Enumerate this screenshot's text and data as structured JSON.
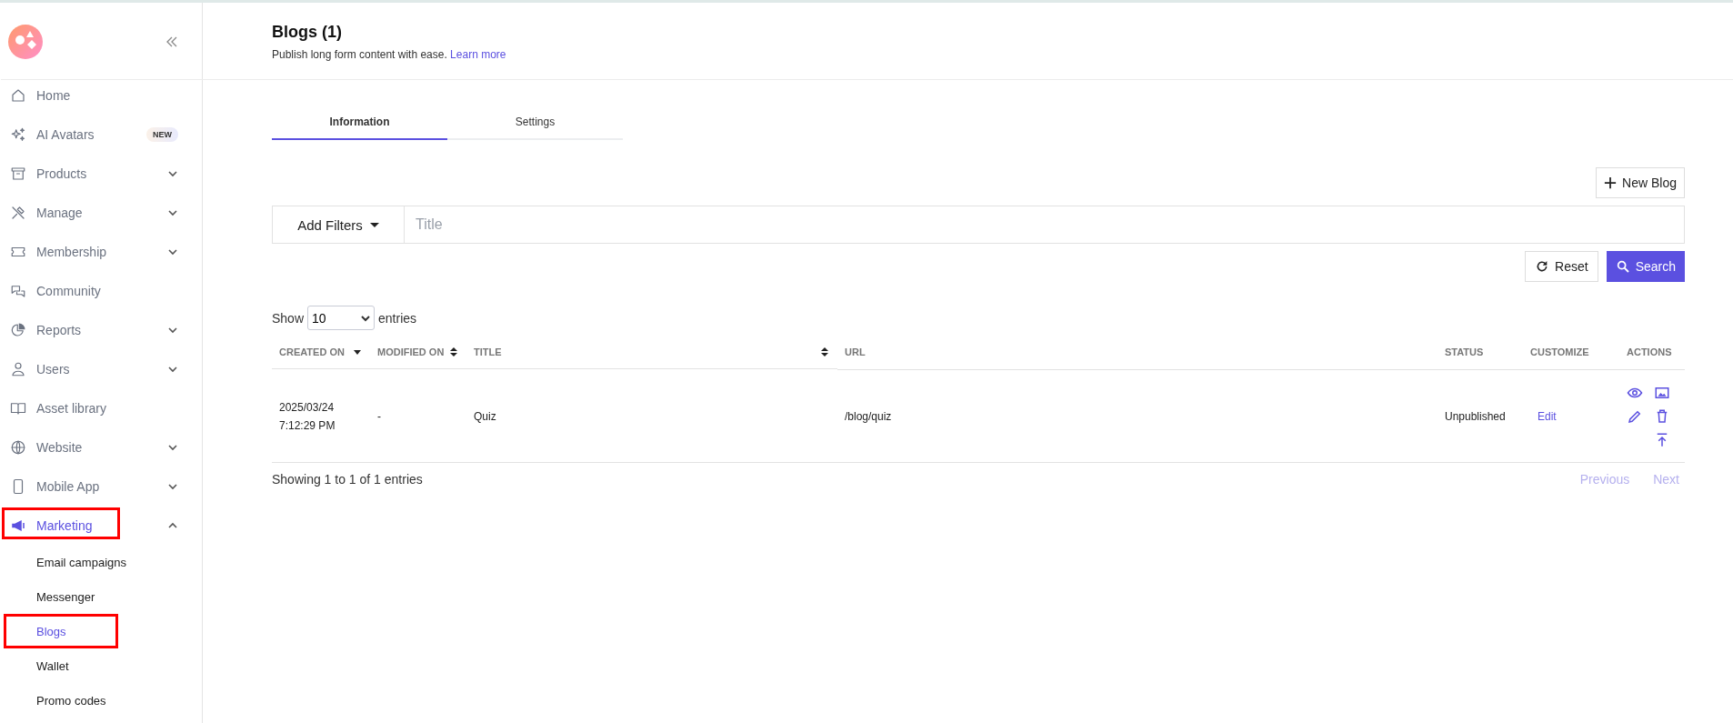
{
  "sidebar": {
    "items": [
      {
        "label": "Home",
        "has_chevron": false,
        "selected": false,
        "highlighted": false
      },
      {
        "label": "AI Avatars",
        "badge": "NEW",
        "has_chevron": false,
        "selected": false,
        "highlighted": false
      },
      {
        "label": "Products",
        "has_chevron": true,
        "expanded": false,
        "selected": false,
        "highlighted": false
      },
      {
        "label": "Manage",
        "has_chevron": true,
        "expanded": false,
        "selected": false,
        "highlighted": false
      },
      {
        "label": "Membership",
        "has_chevron": true,
        "expanded": false,
        "selected": false,
        "highlighted": false
      },
      {
        "label": "Community",
        "has_chevron": false,
        "selected": false,
        "highlighted": false
      },
      {
        "label": "Reports",
        "has_chevron": true,
        "expanded": false,
        "selected": false,
        "highlighted": false
      },
      {
        "label": "Users",
        "has_chevron": true,
        "expanded": false,
        "selected": false,
        "highlighted": false
      },
      {
        "label": "Asset library",
        "has_chevron": false,
        "selected": false,
        "highlighted": false
      },
      {
        "label": "Website",
        "has_chevron": true,
        "expanded": false,
        "selected": false,
        "highlighted": false
      },
      {
        "label": "Mobile App",
        "has_chevron": true,
        "expanded": false,
        "selected": false,
        "highlighted": false
      },
      {
        "label": "Marketing",
        "has_chevron": true,
        "expanded": true,
        "selected": true,
        "highlighted": true,
        "children": [
          {
            "label": "Email campaigns",
            "selected": false,
            "highlighted": false
          },
          {
            "label": "Messenger",
            "selected": false,
            "highlighted": false
          },
          {
            "label": "Blogs",
            "selected": true,
            "highlighted": true
          },
          {
            "label": "Wallet",
            "selected": false,
            "highlighted": false
          },
          {
            "label": "Promo codes",
            "selected": false,
            "highlighted": false
          }
        ]
      }
    ]
  },
  "header": {
    "title": "Blogs (1)",
    "subtitle": "Publish long form content with ease.",
    "link": "Learn more"
  },
  "tabs": [
    {
      "label": "Information",
      "selected": true
    },
    {
      "label": "Settings",
      "selected": false
    }
  ],
  "new_button": "New Blog",
  "filters": {
    "button": "Add Filters",
    "placeholder": "Title"
  },
  "reset_button": "Reset",
  "search_button": "Search",
  "page_size": {
    "before": "Show",
    "value": "10",
    "after": "entries"
  },
  "table": {
    "columns": [
      {
        "label": "CREATED ON",
        "sortable": true,
        "sorted": true
      },
      {
        "label": "MODIFIED ON",
        "sortable": true,
        "sorted": false
      },
      {
        "label": "TITLE",
        "sortable": true,
        "sorted": false
      },
      {
        "label": "URL",
        "sortable": false
      },
      {
        "label": "STATUS",
        "sortable": false
      },
      {
        "label": "CUSTOMIZE",
        "sortable": false
      },
      {
        "label": "ACTIONS",
        "sortable": false
      }
    ],
    "rows": [
      {
        "created": [
          "2025/03/24",
          "7:12:29 PM"
        ],
        "modified": "-",
        "title": "Quiz",
        "url": "/blog/quiz",
        "status": "Unpublished",
        "customize": "Edit"
      }
    ]
  },
  "footer": {
    "info": "Showing 1 to 1 of 1 entries",
    "previous": "Previous",
    "next": "Next"
  }
}
